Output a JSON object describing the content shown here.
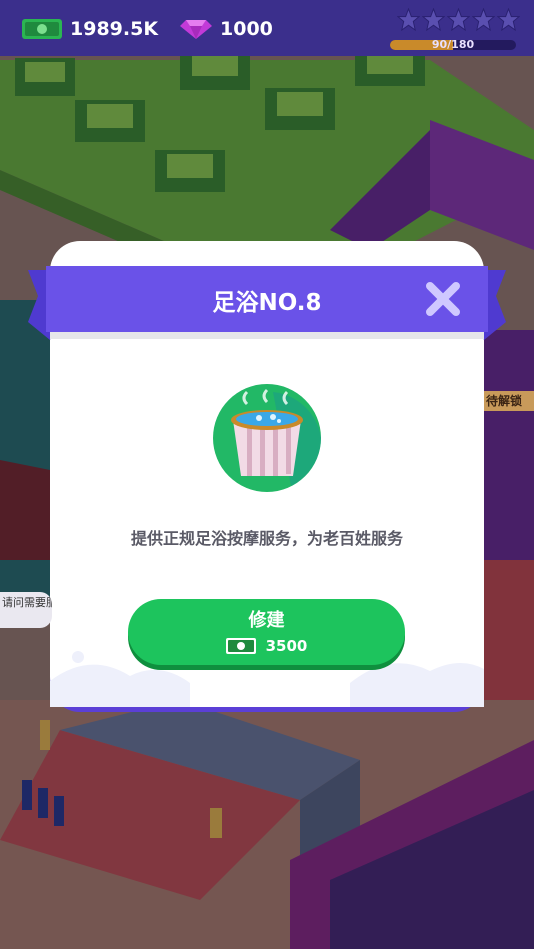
{
  "hud": {
    "cash": "1989.5K",
    "gems": "1000",
    "star_count": 5,
    "stars_filled": 0,
    "xp_text": "90/180",
    "xp_progress": 0.5
  },
  "dialog": {
    "title": "足浴NO.8",
    "description": "提供正规足浴按摩服务，为老百姓服务",
    "build_button": {
      "label": "修建",
      "cost": "3500"
    }
  },
  "scene_text": {
    "unlock_sign": "待解锁",
    "speech_bubble": "请问需要服"
  },
  "colors": {
    "hud_bg": "#3b2f8c",
    "ribbon": "#6a52e8",
    "build_button": "#1dc45d",
    "gem": "#c23ad8",
    "cash": "#2bb552"
  },
  "icons": [
    "cash-icon",
    "gem-icon",
    "star-icon",
    "close-icon",
    "foot-bath-tub-icon"
  ]
}
